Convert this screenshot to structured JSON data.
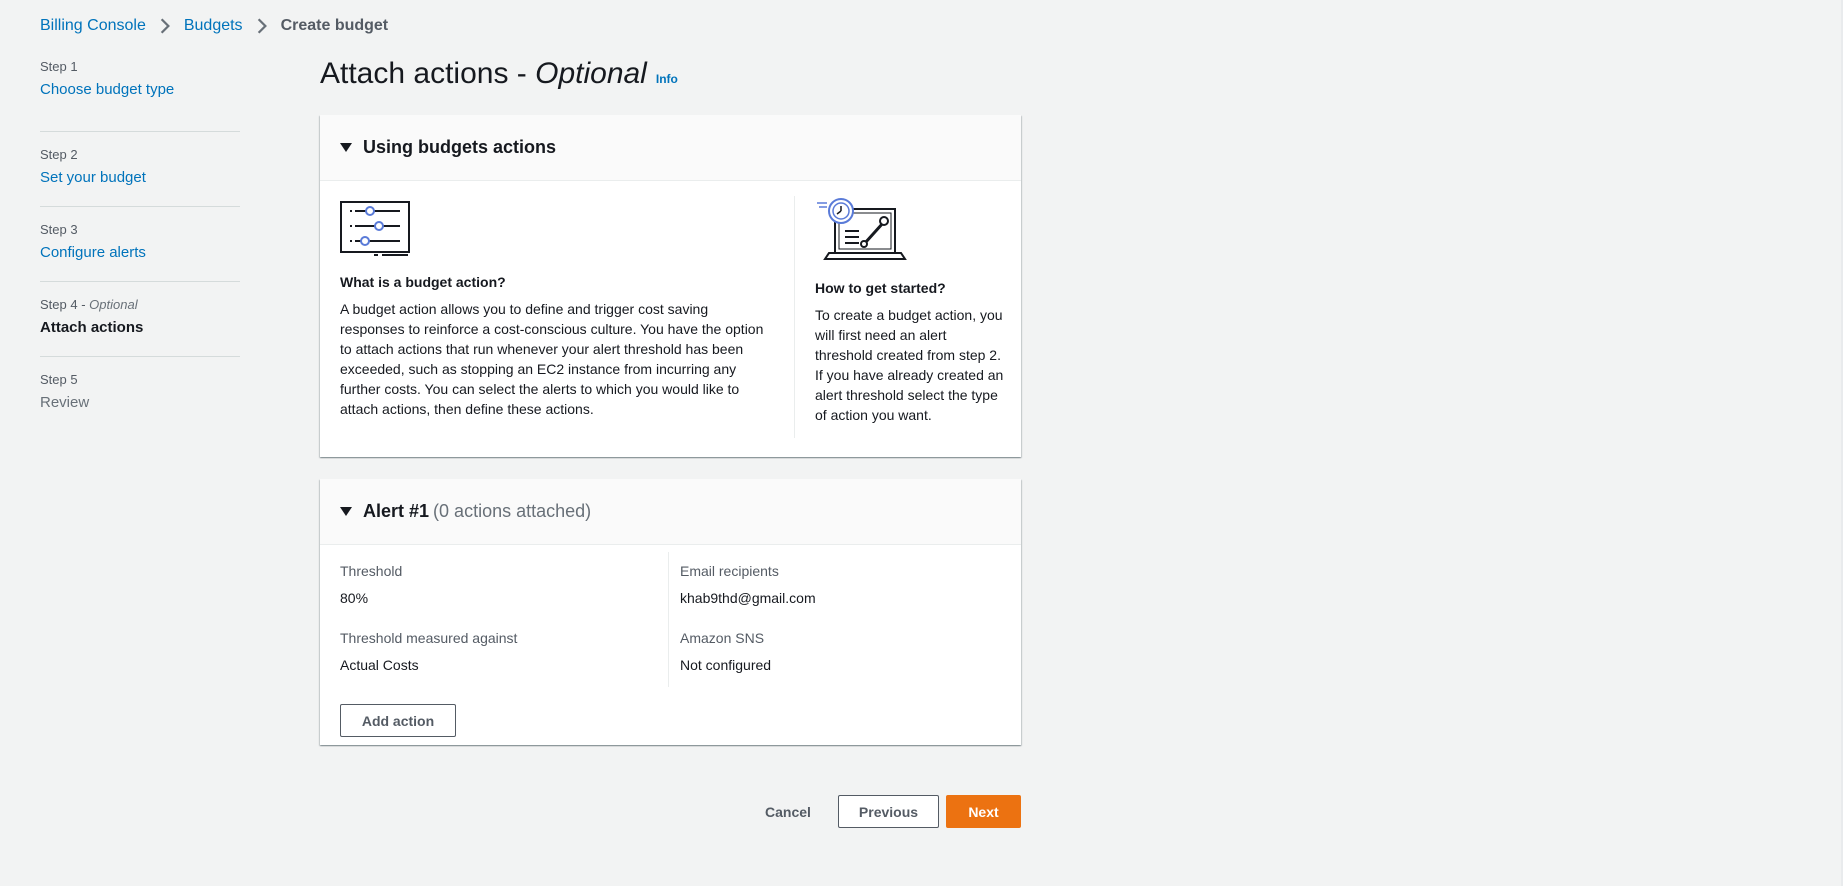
{
  "breadcrumb": {
    "items": [
      "Billing Console",
      "Budgets"
    ],
    "current": "Create budget"
  },
  "steps": [
    {
      "number": "Step 1",
      "title": "Choose budget type"
    },
    {
      "number": "Step 2",
      "title": "Set your budget"
    },
    {
      "number": "Step 3",
      "title": "Configure alerts"
    },
    {
      "number": "Step 4",
      "optional": "Optional",
      "title": "Attach actions"
    },
    {
      "number": "Step 5",
      "title": "Review"
    }
  ],
  "page": {
    "title": "Attach actions - ",
    "title_optional": "Optional",
    "info": "Info"
  },
  "using_panel": {
    "title": "Using budgets actions",
    "left_heading": "What is a budget action?",
    "left_text": "A budget action allows you to define and trigger cost saving responses to reinforce a cost-conscious culture. You have the option to attach actions that run whenever your alert threshold has been exceeded, such as stopping an EC2 instance from incurring any further costs. You can select the alerts to which you would like to attach actions, then define these actions.",
    "right_heading": "How to get started?",
    "right_text": "To create a budget action, you will first need an alert threshold created from step 2. If you have already created an alert threshold select the type of action you want."
  },
  "alert_panel": {
    "title": "Alert #1",
    "count": "(0 actions attached)",
    "threshold_label": "Threshold",
    "threshold_value": "80%",
    "measured_label": "Threshold measured against",
    "measured_value": "Actual Costs",
    "email_label": "Email recipients",
    "email_value": "khab9thd@gmail.com",
    "sns_label": "Amazon SNS",
    "sns_value": "Not configured",
    "add_action": "Add action"
  },
  "footer": {
    "cancel": "Cancel",
    "previous": "Previous",
    "next": "Next"
  },
  "colors": {
    "link": "#0073bb",
    "primary": "#ec7211",
    "background": "#f2f3f3"
  }
}
